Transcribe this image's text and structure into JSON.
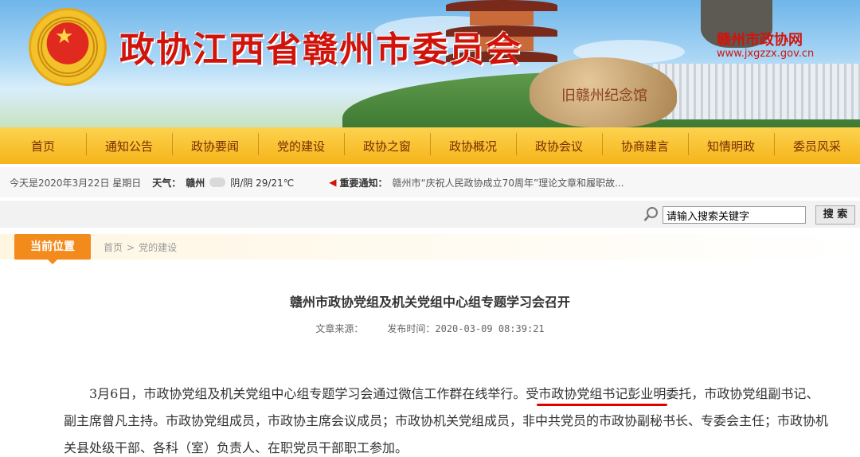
{
  "header": {
    "site_title": "政协江西省赣州市委员会",
    "site_name": "赣州市政协网",
    "site_url": "www.jxgzzx.gov.cn",
    "rock_text": "旧赣州纪念馆"
  },
  "nav": {
    "items": [
      "首页",
      "通知公告",
      "政协要闻",
      "党的建设",
      "政协之窗",
      "政协概况",
      "政协会议",
      "协商建言",
      "知情明政",
      "委员风采"
    ]
  },
  "infobar": {
    "date": "今天是2020年3月22日  星期日",
    "weather_label": "天气：",
    "city": "赣州",
    "weather": "阴/阴 29/21℃",
    "notice_label": "重要通知：",
    "notice_text": "赣州市“庆祝人民政协成立70周年”理论文章和履职故..."
  },
  "search": {
    "value": "请输入搜索关键字",
    "button_label": "搜 索"
  },
  "location": {
    "label": "当前位置",
    "crumbs": [
      "首页",
      "党的建设"
    ],
    "sep": ">"
  },
  "article": {
    "title": "赣州市政协党组及机关党组中心组专题学习会召开",
    "source_label": "文章来源：",
    "publish_label": "发布时间：",
    "publish_time": "2020-03-09 08:39:21",
    "body_part1": "3月6日，市政协党组及机关党组中心组专题学习会通过微信工作群在线举行。受",
    "body_highlight": "市政协党组书记彭业明",
    "body_part2": "委托，市政协党组副书记、副主席曾凡主持。市政协党组成员，市政协主席会议成员；市政协机关党组成员，非中共党员的市政协副秘书长、专委会主任；市政协机关县处级干部、各科（室）负责人、在职党员干部职工参加。"
  },
  "colors": {
    "brand_red": "#d0140b",
    "nav_yellow": "#f5b41a",
    "location_orange": "#f28a1c",
    "highlight_red": "#e00000"
  }
}
